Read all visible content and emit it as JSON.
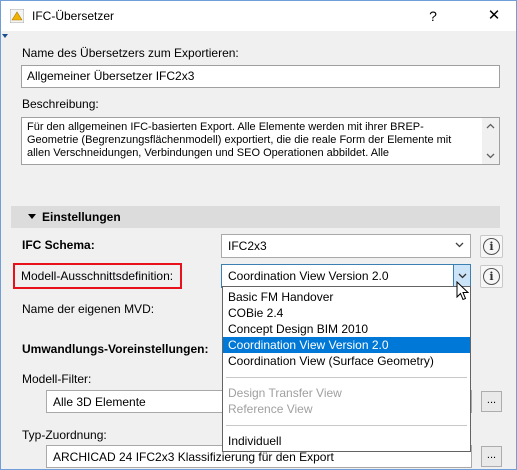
{
  "window": {
    "title": "IFC-Übersetzer",
    "help_label": "?",
    "close_label": "✕"
  },
  "translator": {
    "name_label": "Name des Übersetzers zum Exportieren:",
    "name_value": "Allgemeiner Übersetzer IFC2x3",
    "description_label": "Beschreibung:",
    "description_lines": [
      "Für den allgemeinen IFC-basierten Export. Alle Elemente werden mit ihrer BREP-",
      "Geometrie (Begrenzungsflächenmodell) exportiert, die die reale Form der Elemente mit",
      "allen Verschneidungen, Verbindungen und SEO Operationen abbildet. Alle"
    ]
  },
  "settings": {
    "section_title": "Einstellungen",
    "ifc_schema_label": "IFC Schema:",
    "ifc_schema_value": "IFC2x3",
    "mvd_label": "Modell-Ausschnittsdefinition:",
    "mvd_value": "Coordination View Version 2.0",
    "own_mvd_label": "Name der eigenen MVD:",
    "conversion_label": "Umwandlungs-Voreinstellungen:",
    "model_filter_label": "Modell-Filter:",
    "model_filter_value": "Alle 3D Elemente",
    "type_mapping_label": "Typ-Zuordnung:",
    "type_mapping_value": "ARCHICAD 24 IFC2x3 Klassifizierung für den Export",
    "dots_label": "...",
    "info_label": "i"
  },
  "dropdown": {
    "group1": [
      "Basic FM Handover",
      "COBie 2.4",
      "Concept Design BIM 2010",
      "Coordination View Version 2.0",
      "Coordination View (Surface Geometry)"
    ],
    "selected_index": 3,
    "group2": [
      "Design Transfer View",
      "Reference View"
    ],
    "group3": [
      "Individuell"
    ]
  },
  "colors": {
    "accent": "#0078d7",
    "highlight_border": "#e8101a",
    "window_border": "#6f9fd6"
  }
}
